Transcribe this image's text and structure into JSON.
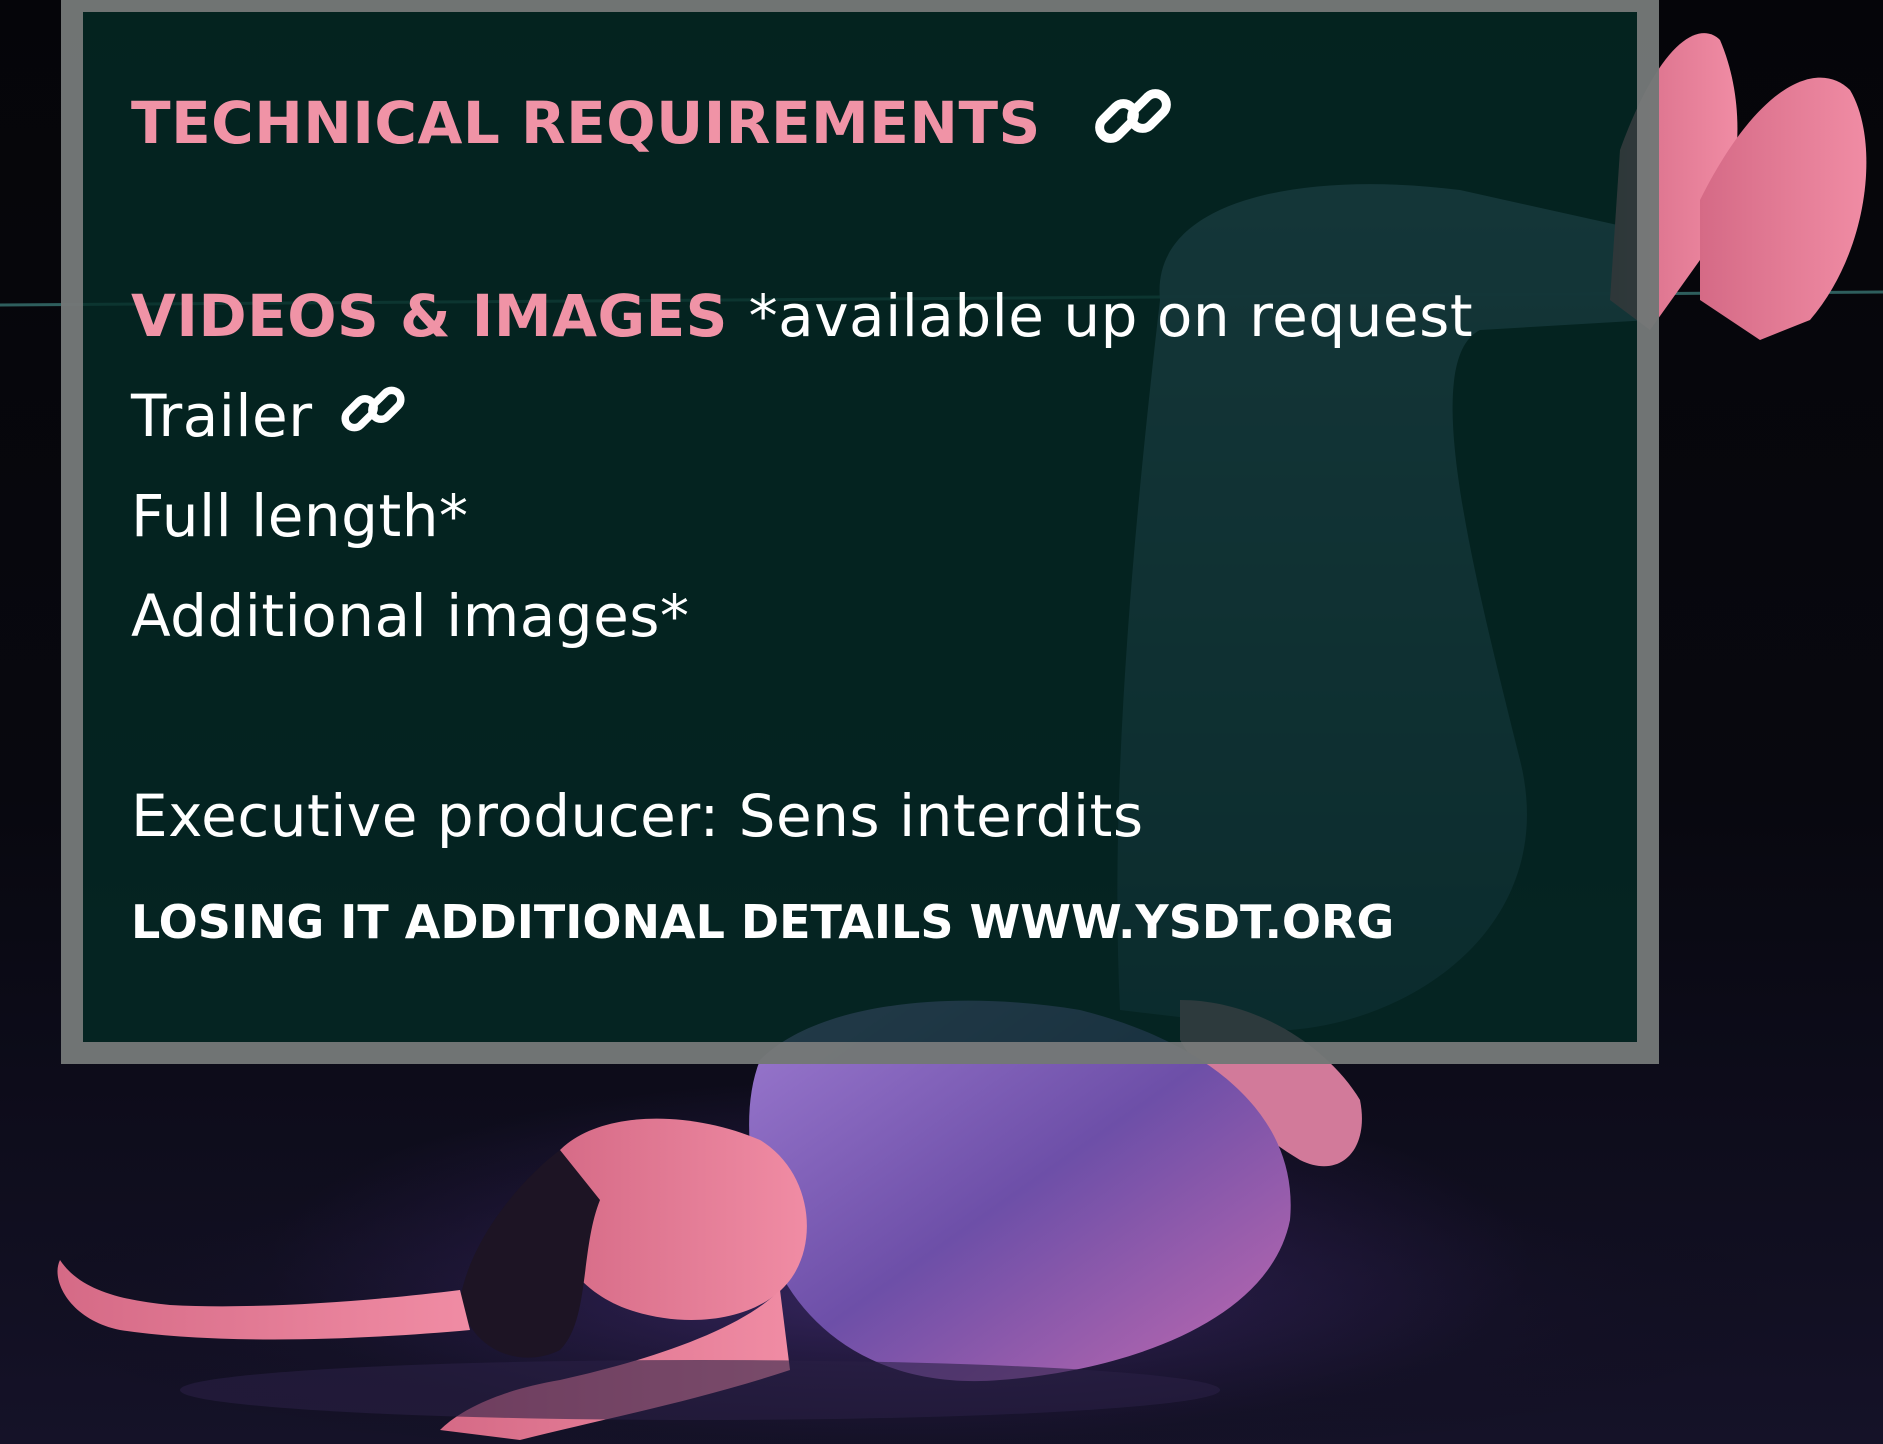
{
  "background": {
    "photo_description_icon": "dancer-photo",
    "accent_color": "#f093a6",
    "panel_color": "#042a26"
  },
  "technical": {
    "heading": "TECHNICAL REQUIREMENTS",
    "icon": "link-icon"
  },
  "videos": {
    "heading": "VIDEOS & IMAGES",
    "note": "*available up on request",
    "items": [
      {
        "label": "Trailer",
        "icon": "link-icon"
      },
      {
        "label": "Full length*"
      },
      {
        "label": "Additional images*"
      }
    ]
  },
  "producer": {
    "text": "Executive producer: Sens interdits"
  },
  "footer": {
    "text": "LOSING IT ADDITIONAL DETAILS WWW.YSDT.ORG"
  }
}
